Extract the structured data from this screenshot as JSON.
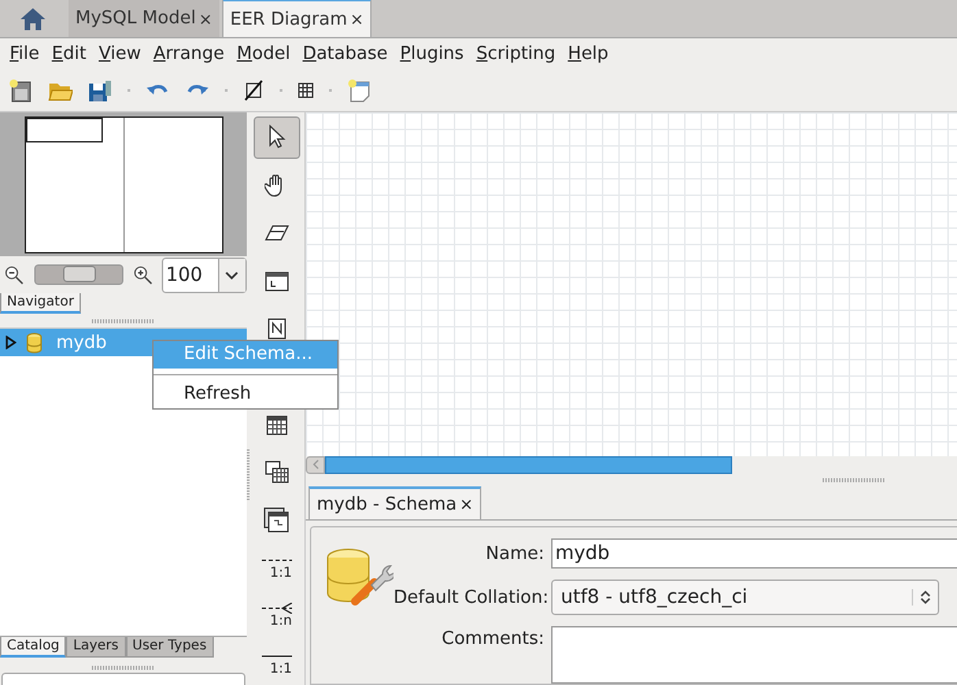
{
  "document_tabs": [
    {
      "kind": "home",
      "selected": false
    },
    {
      "kind": "doc",
      "label": "MySQL Model",
      "close": "×",
      "selected": false
    },
    {
      "kind": "doc",
      "label": "EER Diagram",
      "close": "×",
      "selected": true
    }
  ],
  "menu": [
    "File",
    "Edit",
    "View",
    "Arrange",
    "Model",
    "Database",
    "Plugins",
    "Scripting",
    "Help"
  ],
  "toolbar": [
    {
      "kind": "new"
    },
    {
      "kind": "open"
    },
    {
      "kind": "save"
    },
    {
      "kind": "sep"
    },
    {
      "kind": "undo"
    },
    {
      "kind": "redo"
    },
    {
      "kind": "sep"
    },
    {
      "kind": "toggle-grid"
    },
    {
      "kind": "sep"
    },
    {
      "kind": "grid"
    },
    {
      "kind": "sep"
    },
    {
      "kind": "new-diagram"
    }
  ],
  "navigator": {
    "zoom": "100",
    "zoom_slider": {
      "level": 0.45
    },
    "tab": "Navigator"
  },
  "catalog_tree": [
    {
      "label": "mydb",
      "selected": true,
      "expanded": false
    }
  ],
  "context_menu": [
    {
      "kind": "item",
      "label": "Edit Schema...",
      "selected": true
    },
    {
      "kind": "separator"
    },
    {
      "kind": "item",
      "label": "Refresh",
      "selected": false
    }
  ],
  "sidebar_tabs": [
    {
      "label": "Catalog",
      "selected": true
    },
    {
      "label": "Layers",
      "selected": false
    },
    {
      "label": "User Types",
      "selected": false
    }
  ],
  "tools": [
    {
      "kind": "pointer",
      "selected": true
    },
    {
      "kind": "hand",
      "selected": false
    },
    {
      "kind": "eraser",
      "selected": false
    },
    {
      "kind": "layer",
      "selected": false
    },
    {
      "kind": "note",
      "selected": false
    },
    {
      "kind": "table",
      "selected": false
    },
    {
      "kind": "view",
      "selected": false
    },
    {
      "kind": "routine",
      "selected": false
    },
    {
      "kind": "rel11",
      "label": "1:1",
      "selected": false
    },
    {
      "kind": "rel1n",
      "label": "1:n",
      "selected": false
    },
    {
      "kind": "rel11b",
      "label": "1:1",
      "selected": false
    }
  ],
  "editor": {
    "tab": {
      "label": "mydb - Schema",
      "close": "×"
    },
    "name_label": "Name:",
    "name": "mydb",
    "collation_label": "Default Collation:",
    "collation": "utf8 - utf8_czech_ci",
    "comments_label": "Comments:"
  }
}
